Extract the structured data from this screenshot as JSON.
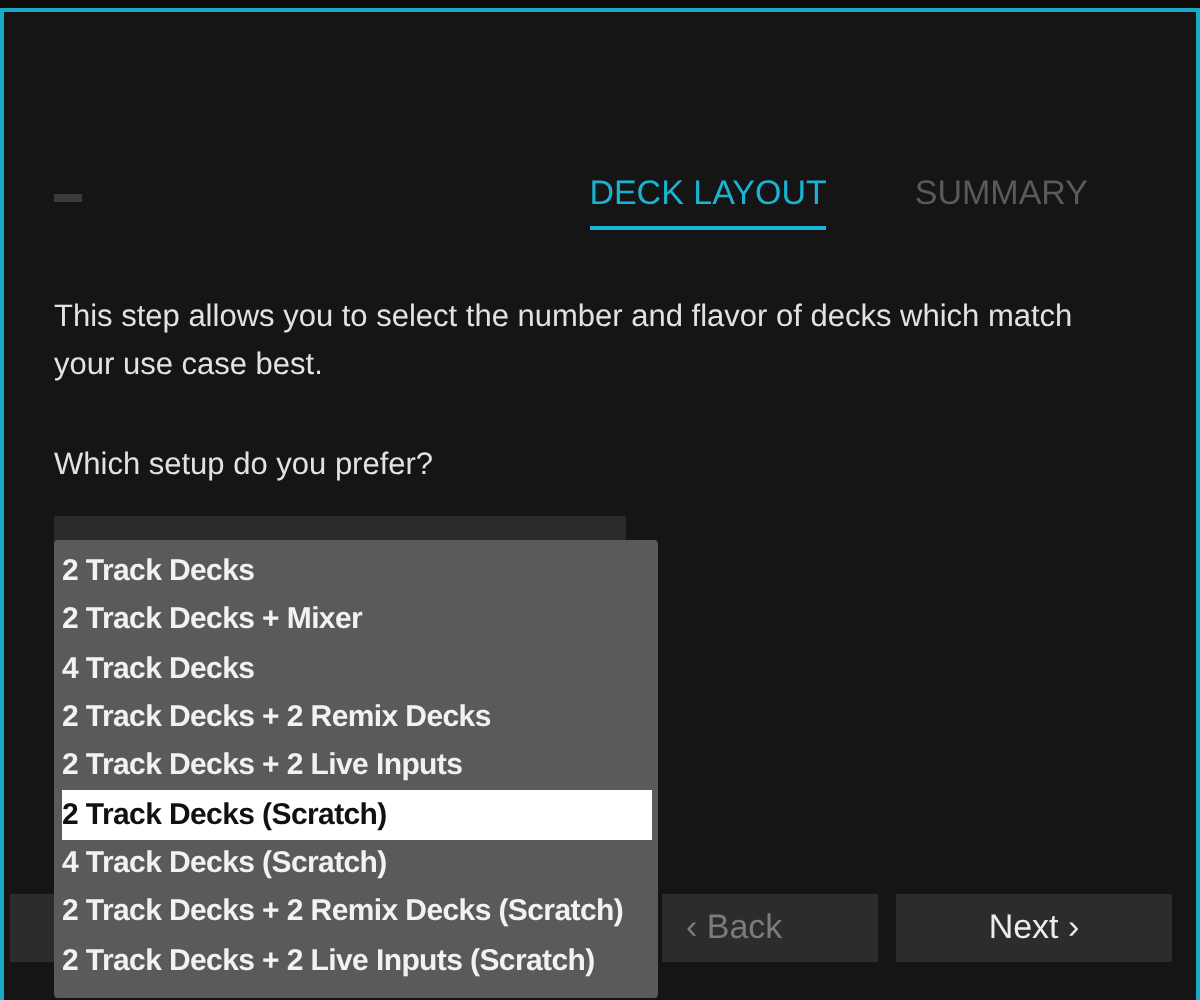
{
  "tabs": [
    {
      "label": "DECK LAYOUT",
      "selected": true
    },
    {
      "label": "SUMMARY",
      "selected": false
    }
  ],
  "intro": "This step allows you to select the number and flavor of decks which match your use case best.",
  "question": "Which setup do you prefer?",
  "dropdown": {
    "expanded": true,
    "options": [
      {
        "label": "2 Track Decks",
        "selected": false
      },
      {
        "label": "2 Track Decks + Mixer",
        "selected": false
      },
      {
        "label": "4 Track Decks",
        "selected": false
      },
      {
        "label": "2 Track Decks + 2 Remix Decks",
        "selected": false
      },
      {
        "label": "2 Track Decks + 2 Live Inputs",
        "selected": false
      },
      {
        "label": "2 Track Decks (Scratch)",
        "selected": true
      },
      {
        "label": "4 Track Decks (Scratch)",
        "selected": false
      },
      {
        "label": "2 Track Decks + 2 Remix Decks (Scratch)",
        "selected": false
      },
      {
        "label": "2 Track Decks + 2 Live Inputs (Scratch)",
        "selected": false
      }
    ]
  },
  "buttons": [
    {
      "label": "‹ Back",
      "disabled": true
    },
    {
      "label": "Next ›",
      "disabled": false
    }
  ]
}
